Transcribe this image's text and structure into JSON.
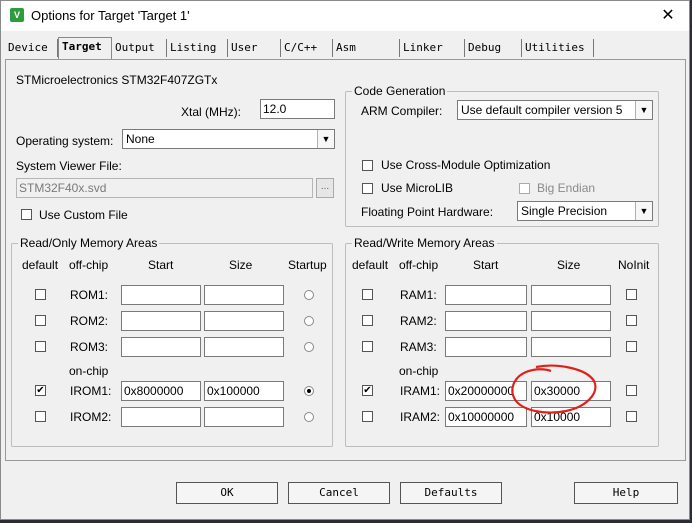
{
  "window": {
    "title": "Options for Target 'Target 1'",
    "close_glyph": "✕",
    "app_icon": "keil-uvision-icon"
  },
  "tabs": [
    "Device",
    "Target",
    "Output",
    "Listing",
    "User",
    "C/C++",
    "Asm",
    "Linker",
    "Debug",
    "Utilities"
  ],
  "active_tab": "Target",
  "device_name": "STMicroelectronics STM32F407ZGTx",
  "xtal": {
    "label": "Xtal (MHz):",
    "value": "12.0"
  },
  "os": {
    "label": "Operating system:",
    "value": "None"
  },
  "svd": {
    "label": "System Viewer File:",
    "value": "STM32F40x.svd",
    "browse": "..."
  },
  "custom_file": {
    "label": "Use Custom File",
    "checked": false
  },
  "codegen": {
    "title": "Code Generation",
    "compiler_label": "ARM Compiler:",
    "compiler_value": "Use default compiler version 5",
    "cross_module": "Use Cross-Module Optimization",
    "microlib": "Use MicroLIB",
    "big_endian": "Big Endian",
    "fpu_label": "Floating Point Hardware:",
    "fpu_value": "Single Precision"
  },
  "rom": {
    "title": "Read/Only Memory Areas",
    "headers": {
      "default": "default",
      "offchip": "off-chip",
      "start": "Start",
      "size": "Size",
      "flag": "Startup"
    },
    "onchip_label": "on-chip",
    "rows": [
      {
        "name": "ROM1:",
        "start": "",
        "size": "",
        "checked": false,
        "startup": false
      },
      {
        "name": "ROM2:",
        "start": "",
        "size": "",
        "checked": false,
        "startup": false
      },
      {
        "name": "ROM3:",
        "start": "",
        "size": "",
        "checked": false,
        "startup": false
      },
      {
        "name": "IROM1:",
        "start": "0x8000000",
        "size": "0x100000",
        "checked": true,
        "startup": true
      },
      {
        "name": "IROM2:",
        "start": "",
        "size": "",
        "checked": false,
        "startup": false
      }
    ]
  },
  "ram": {
    "title": "Read/Write Memory Areas",
    "headers": {
      "default": "default",
      "offchip": "off-chip",
      "start": "Start",
      "size": "Size",
      "flag": "NoInit"
    },
    "onchip_label": "on-chip",
    "rows": [
      {
        "name": "RAM1:",
        "start": "",
        "size": "",
        "checked": false,
        "noinit": false
      },
      {
        "name": "RAM2:",
        "start": "",
        "size": "",
        "checked": false,
        "noinit": false
      },
      {
        "name": "RAM3:",
        "start": "",
        "size": "",
        "checked": false,
        "noinit": false
      },
      {
        "name": "IRAM1:",
        "start": "0x20000000",
        "size": "0x30000",
        "checked": true,
        "noinit": false
      },
      {
        "name": "IRAM2:",
        "start": "0x10000000",
        "size": "0x10000",
        "checked": false,
        "noinit": false
      }
    ]
  },
  "buttons": {
    "ok": "OK",
    "cancel": "Cancel",
    "defaults": "Defaults",
    "help": "Help"
  },
  "annotation_color": "#e0201c"
}
